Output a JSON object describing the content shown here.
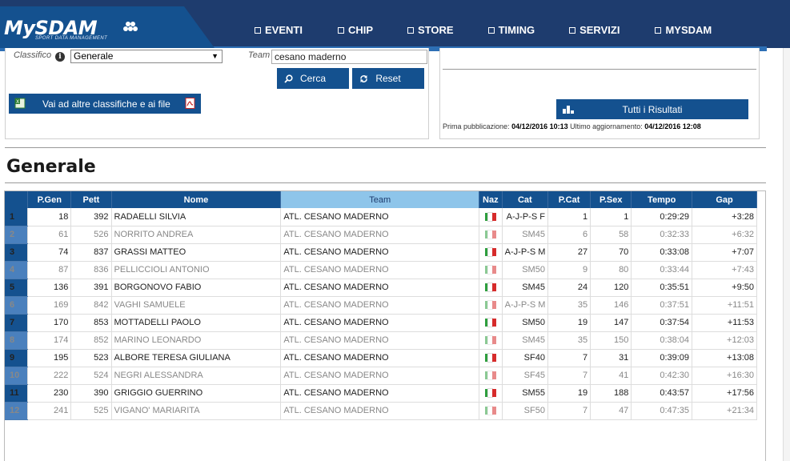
{
  "brand": {
    "name": "MySDAM",
    "tagline": "SPORT DATA MANAGEMENT"
  },
  "nav": [
    {
      "label": "EVENTI"
    },
    {
      "label": "CHIP"
    },
    {
      "label": "STORE"
    },
    {
      "label": "TIMING"
    },
    {
      "label": "SERVIZI"
    },
    {
      "label": "MYSDAM"
    }
  ],
  "filters": {
    "classifica_label": "Classifico",
    "classifica_value": "Generale",
    "team_label": "Team",
    "team_value": "cesano maderno",
    "search_label": "Cerca",
    "reset_label": "Reset",
    "other_label": "Vai ad altre classifiche e ai file"
  },
  "results": {
    "all_label": "Tutti i Risultati",
    "first_pub_label": "Prima pubblicazione:",
    "first_pub_value": "04/12/2016 10:13",
    "last_update_label": "Ultimo aggiornamento:",
    "last_update_value": "04/12/2016 12:08"
  },
  "page_title": "Generale",
  "table": {
    "columns": [
      "",
      "P.Gen",
      "Pett",
      "Nome",
      "Team",
      "Naz",
      "Cat",
      "P.Cat",
      "P.Sex",
      "Tempo",
      "Gap"
    ],
    "rows": [
      [
        "1",
        "18",
        "392",
        "RADAELLI SILVIA",
        "ATL. CESANO MADERNO",
        "",
        "A-J-P-S F",
        "1",
        "1",
        "0:29:29",
        "+3:28"
      ],
      [
        "2",
        "61",
        "526",
        "NORRITO ANDREA",
        "ATL. CESANO MADERNO",
        "",
        "SM45",
        "6",
        "58",
        "0:32:33",
        "+6:32"
      ],
      [
        "3",
        "74",
        "837",
        "GRASSI MATTEO",
        "ATL. CESANO MADERNO",
        "",
        "A-J-P-S M",
        "27",
        "70",
        "0:33:08",
        "+7:07"
      ],
      [
        "4",
        "87",
        "836",
        "PELLICCIOLI ANTONIO",
        "ATL. CESANO MADERNO",
        "",
        "SM50",
        "9",
        "80",
        "0:33:44",
        "+7:43"
      ],
      [
        "5",
        "136",
        "391",
        "BORGONOVO FABIO",
        "ATL. CESANO MADERNO",
        "",
        "SM45",
        "24",
        "120",
        "0:35:51",
        "+9:50"
      ],
      [
        "6",
        "169",
        "842",
        "VAGHI SAMUELE",
        "ATL. CESANO MADERNO",
        "",
        "A-J-P-S M",
        "35",
        "146",
        "0:37:51",
        "+11:51"
      ],
      [
        "7",
        "170",
        "853",
        "MOTTADELLI PAOLO",
        "ATL. CESANO MADERNO",
        "",
        "SM50",
        "19",
        "147",
        "0:37:54",
        "+11:53"
      ],
      [
        "8",
        "174",
        "852",
        "MARINO LEONARDO",
        "ATL. CESANO MADERNO",
        "",
        "SM45",
        "35",
        "150",
        "0:38:04",
        "+12:03"
      ],
      [
        "9",
        "195",
        "523",
        "ALBORE TERESA GIULIANA",
        "ATL. CESANO MADERNO",
        "",
        "SF40",
        "7",
        "31",
        "0:39:09",
        "+13:08"
      ],
      [
        "10",
        "222",
        "524",
        "NEGRI ALESSANDRA",
        "ATL. CESANO MADERNO",
        "",
        "SF45",
        "7",
        "41",
        "0:42:30",
        "+16:30"
      ],
      [
        "11",
        "230",
        "390",
        "GRIGGIO GUERRINO",
        "ATL. CESANO MADERNO",
        "",
        "SM55",
        "19",
        "188",
        "0:43:57",
        "+17:56"
      ],
      [
        "12",
        "241",
        "525",
        "VIGANO' MARIARITA",
        "ATL. CESANO MADERNO",
        "",
        "SF50",
        "7",
        "47",
        "0:47:35",
        "+21:34"
      ]
    ]
  },
  "colors": {
    "brand_dark": "#1e3c6e",
    "brand": "#14518f",
    "team_header": "#8ec5ea"
  }
}
